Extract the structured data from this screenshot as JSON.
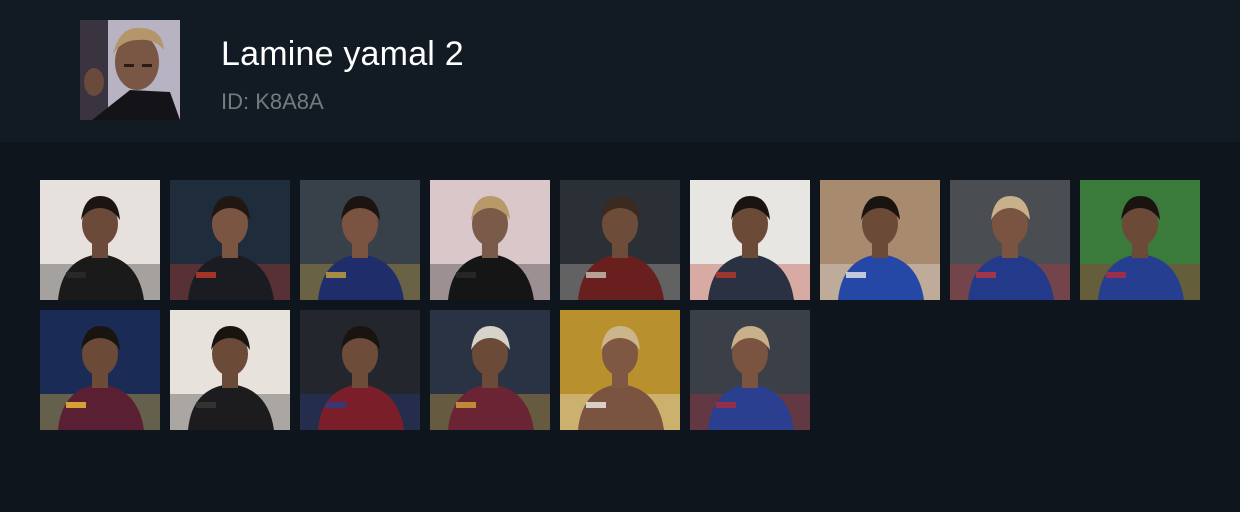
{
  "profile": {
    "name": "Lamine yamal 2",
    "id_label": "ID: K8A8A"
  },
  "colors": {
    "page_background": "#0e151d",
    "header_background": "#121a23",
    "title_text": "#ffffff",
    "id_text": "#747a80"
  },
  "icons": {
    "avatar": "person-portrait"
  },
  "gallery": {
    "row_counts": [
      9,
      6
    ],
    "thumbnails": [
      {
        "bg": "#e6e1dc",
        "person": "#1a1a1a",
        "skin": "#6b4a39",
        "hair": "#1b1410",
        "accent": "#2c2c2c"
      },
      {
        "bg": "#1e2c3c",
        "person": "#1b1c22",
        "skin": "#7a5642",
        "hair": "#201712",
        "accent": "#c43b2a"
      },
      {
        "bg": "#38404a",
        "person": "#1f2e6b",
        "skin": "#7a5440",
        "hair": "#1c1410",
        "accent": "#c7a43c"
      },
      {
        "bg": "#d9c7c9",
        "person": "#151515",
        "skin": "#7a5a48",
        "hair": "#b89a6a",
        "accent": "#2a2a2a"
      },
      {
        "bg": "#2b2f36",
        "person": "#6a1f1f",
        "skin": "#6e4c3a",
        "hair": "#3a2a20",
        "accent": "#c9c2b5"
      },
      {
        "bg": "#e8e6e2",
        "person": "#2a3142",
        "skin": "#6b4a38",
        "hair": "#1a1410",
        "accent": "#b83a30"
      },
      {
        "bg": "#a88a6e",
        "person": "#2547a6",
        "skin": "#6b4a38",
        "hair": "#1a1410",
        "accent": "#e8e8ea"
      },
      {
        "bg": "#4a4d52",
        "person": "#233a8a",
        "skin": "#7a5440",
        "hair": "#c8b08a",
        "accent": "#c0343a"
      },
      {
        "bg": "#3a7a3a",
        "person": "#263e90",
        "skin": "#6b4a38",
        "hair": "#1a1410",
        "accent": "#b62b3c"
      },
      {
        "bg": "#1a2b55",
        "person": "#5a1f33",
        "skin": "#6b4a38",
        "hair": "#1a1410",
        "accent": "#f2c23a"
      },
      {
        "bg": "#e7e2dc",
        "person": "#1c1c1e",
        "skin": "#6b4a38",
        "hair": "#1a1410",
        "accent": "#3a3a3a"
      },
      {
        "bg": "#23262c",
        "person": "#7a1f2a",
        "skin": "#6e4c3a",
        "hair": "#1a1410",
        "accent": "#2a3d8a"
      },
      {
        "bg": "#2a3344",
        "person": "#6a2433",
        "skin": "#6b4a38",
        "hair": "#d8d3c8",
        "accent": "#d6a33a"
      },
      {
        "bg": "#b8902e",
        "person": "#7a5440",
        "skin": "#7e5842",
        "hair": "#cbb58a",
        "accent": "#f0ede6"
      },
      {
        "bg": "#3a3f48",
        "person": "#2a3f8f",
        "skin": "#7a5440",
        "hair": "#c8b08a",
        "accent": "#b02a3a"
      }
    ]
  }
}
